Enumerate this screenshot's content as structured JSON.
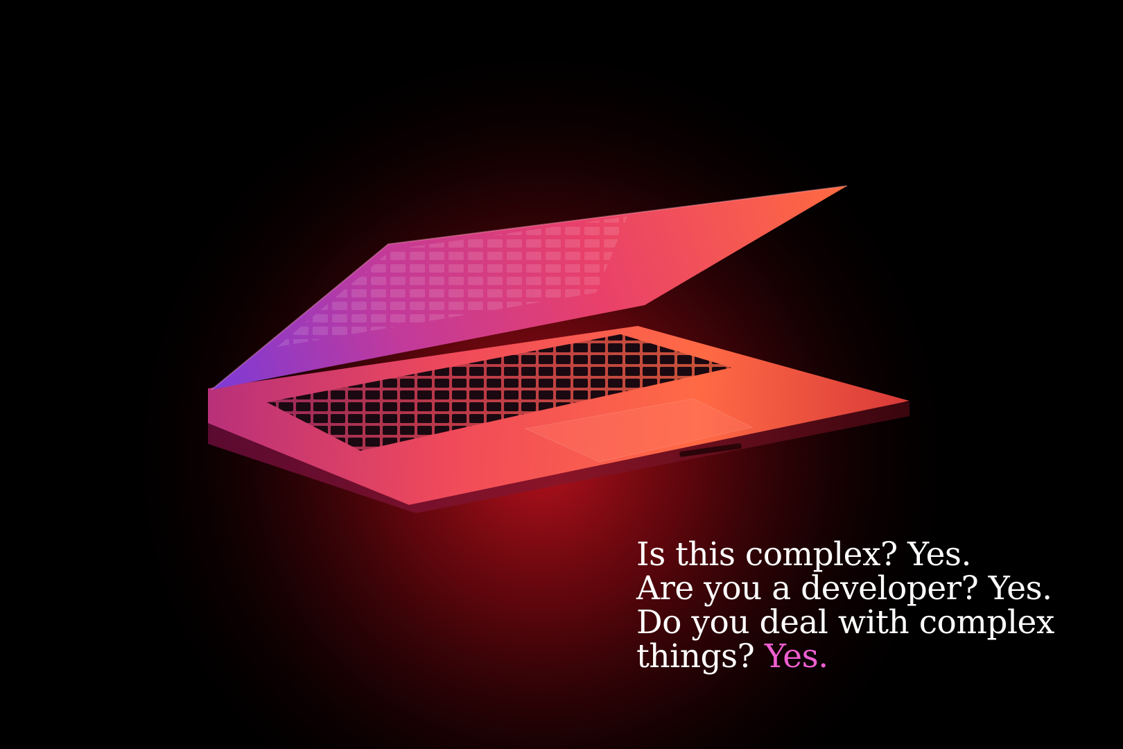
{
  "caption": {
    "line1": "Is this complex? Yes.",
    "line2": "Are you a developer? Yes.",
    "line3": "Do you deal with complex",
    "line4_start": "things?",
    "line4_accent": "Yes."
  },
  "colors": {
    "background": "#000000",
    "text": "#ffffff",
    "accent": "#ee5fd0",
    "screen_glow_start": "#8a3bd6",
    "screen_glow_mid": "#e8306a",
    "screen_glow_end": "#ff6a3a",
    "table_glow": "#b0101c"
  },
  "photo": {
    "subject": "laptop-icon"
  }
}
